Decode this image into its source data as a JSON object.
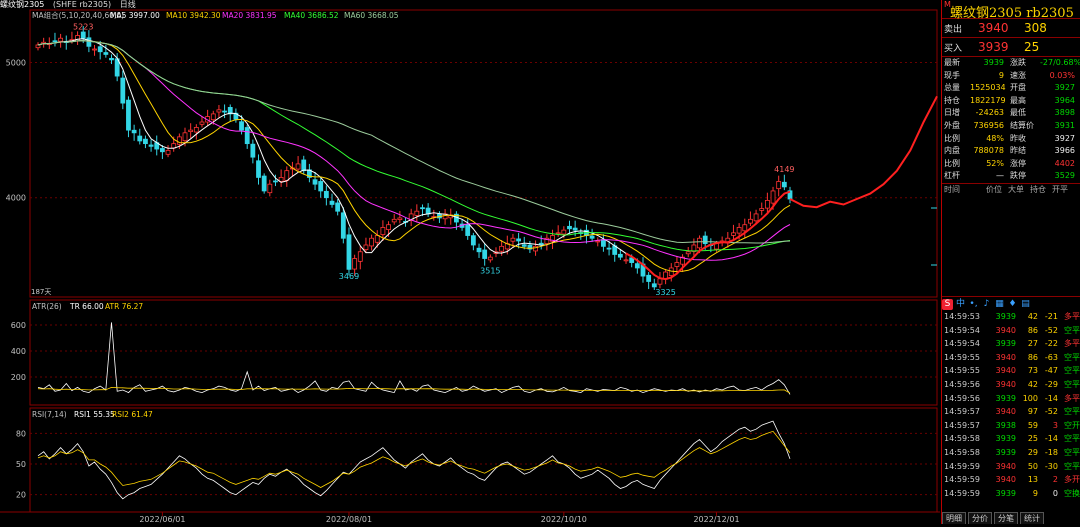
{
  "top_bar": {
    "symbol_label": "螺纹钢2305",
    "code_label": "(SHFE rb2305)",
    "period": "日线",
    "ma_header": "MA组合(5,10,20,40,60,0)",
    "ma5": "MA5 3997.00",
    "ma10": "MA10 3942.30",
    "ma20": "MA20 3831.95",
    "ma40": "MA40 3686.52",
    "ma60": "MA60 3668.05"
  },
  "colors": {
    "up": "#ff3333",
    "down": "#33d6e6",
    "ma5": "#ffffff",
    "ma10": "#ffd400",
    "ma20": "#ff33ff",
    "ma40": "#33ff33",
    "ma60": "#9ccc9c",
    "forecast": "#ff2020"
  },
  "chart_data": [
    {
      "type": "candlestick",
      "title": "螺纹钢2305 日线",
      "y_ticks": [
        "5000",
        "4000"
      ],
      "ylim": [
        3280,
        5300
      ],
      "x_ticks": [
        "2022/06/01",
        "2022/08/01",
        "2022/10/10",
        "2022/12/01"
      ],
      "annotations": {
        "high_1": "5223",
        "low_1": "3469",
        "low_2": "3515",
        "low_3": "3325",
        "high_2": "4149"
      },
      "counter_label": "187天",
      "close": [
        5130,
        5150,
        5140,
        5160,
        5180,
        5150,
        5170,
        5200,
        5180,
        5120,
        5100,
        5080,
        5060,
        5020,
        4900,
        4700,
        4500,
        4480,
        4420,
        4400,
        4380,
        4360,
        4340,
        4350,
        4400,
        4450,
        4480,
        4500,
        4520,
        4560,
        4600,
        4620,
        4650,
        4640,
        4620,
        4580,
        4500,
        4400,
        4300,
        4150,
        4050,
        4100,
        4120,
        4150,
        4200,
        4220,
        4250,
        4200,
        4150,
        4100,
        4050,
        4000,
        3950,
        3900,
        3700,
        3470,
        3550,
        3600,
        3650,
        3700,
        3720,
        3780,
        3800,
        3840,
        3850,
        3820,
        3880,
        3900,
        3920,
        3880,
        3860,
        3850,
        3880,
        3870,
        3820,
        3780,
        3720,
        3650,
        3600,
        3550,
        3560,
        3600,
        3640,
        3660,
        3700,
        3680,
        3640,
        3620,
        3640,
        3660,
        3700,
        3720,
        3740,
        3760,
        3770,
        3760,
        3740,
        3720,
        3700,
        3680,
        3640,
        3620,
        3580,
        3560,
        3540,
        3520,
        3480,
        3420,
        3380,
        3340,
        3400,
        3450,
        3480,
        3520,
        3560,
        3600,
        3650,
        3700,
        3660,
        3650,
        3660,
        3680,
        3700,
        3740,
        3780,
        3800,
        3840,
        3880,
        3920,
        3980,
        4050,
        4120,
        4080,
        3990
      ],
      "ma5": [],
      "forecast": [
        3990,
        3940,
        3930,
        3970,
        3950,
        3990,
        4030,
        4100,
        4200,
        4350,
        4560,
        4750
      ]
    },
    {
      "type": "line",
      "title": "ATR(26)",
      "legend": [
        "TR 66.00",
        "ATR 76.27"
      ],
      "y_ticks": [
        "600",
        "400",
        "200"
      ],
      "ylim": [
        0,
        700
      ],
      "series": [
        {
          "name": "TR 66.00",
          "values": [
            120,
            110,
            140,
            90,
            100,
            150,
            95,
            120,
            90,
            80,
            110,
            130,
            100,
            620,
            90,
            100,
            80,
            120,
            140,
            90,
            100,
            110,
            130,
            95,
            85,
            100,
            120,
            110,
            90,
            80,
            100,
            110,
            130,
            120,
            100,
            90,
            110,
            240,
            100,
            130,
            95,
            110,
            120,
            90,
            100,
            110,
            80,
            100,
            130,
            170,
            100,
            90,
            120,
            110,
            160,
            170,
            110,
            100,
            90,
            160,
            120,
            100,
            90,
            80,
            170,
            100,
            110,
            90,
            130,
            140,
            100,
            90,
            80,
            100,
            120,
            90,
            100,
            130,
            110,
            90,
            100,
            110,
            80,
            100,
            120,
            130,
            90,
            80,
            100,
            110,
            90,
            85,
            100,
            120,
            95,
            90,
            80,
            110,
            100,
            90,
            105,
            100,
            95,
            120,
            110,
            90,
            100,
            80,
            95,
            110,
            100,
            90,
            100,
            95,
            110,
            90,
            100,
            85,
            100,
            90,
            110,
            100,
            120,
            130,
            100,
            95,
            110,
            120,
            100,
            130,
            150,
            180,
            140,
            66
          ]
        },
        {
          "name": "ATR 76.27",
          "values": [
            110,
            108,
            110,
            106,
            104,
            106,
            104,
            104,
            103,
            101,
            101,
            102,
            102,
            120,
            118,
            117,
            114,
            114,
            115,
            113,
            112,
            112,
            113,
            111,
            108,
            108,
            109,
            109,
            107,
            105,
            105,
            105,
            106,
            107,
            106,
            104,
            104,
            109,
            109,
            110,
            109,
            109,
            109,
            108,
            107,
            107,
            106,
            106,
            107,
            109,
            108,
            107,
            107,
            107,
            109,
            112,
            111,
            111,
            109,
            111,
            111,
            110,
            109,
            107,
            110,
            109,
            109,
            109,
            109,
            110,
            109,
            108,
            106,
            106,
            106,
            106,
            105,
            106,
            106,
            105,
            105,
            104,
            103,
            103,
            104,
            104,
            103,
            101,
            101,
            101,
            100,
            99,
            99,
            99,
            99,
            98,
            97,
            97,
            97,
            96,
            96,
            96,
            96,
            97,
            97,
            96,
            96,
            95,
            95,
            95,
            95,
            95,
            95,
            95,
            95,
            94,
            94,
            94,
            94,
            94,
            94,
            94,
            95,
            96,
            96,
            96,
            96,
            96,
            96,
            97,
            98,
            100,
            101,
            76
          ]
        }
      ]
    },
    {
      "type": "line",
      "title": "RSI(7,14)",
      "legend": [
        "RSI1 55.35",
        "RSI2 61.47"
      ],
      "y_ticks": [
        "80",
        "50",
        "20"
      ],
      "ylim": [
        5,
        95
      ],
      "series": [
        {
          "name": "RSI1 55.35",
          "values": [
            58,
            62,
            55,
            60,
            66,
            60,
            64,
            70,
            62,
            48,
            52,
            45,
            40,
            32,
            22,
            16,
            20,
            22,
            26,
            28,
            30,
            35,
            40,
            46,
            52,
            58,
            55,
            50,
            46,
            40,
            36,
            34,
            30,
            26,
            22,
            20,
            24,
            28,
            32,
            30,
            36,
            40,
            38,
            42,
            45,
            40,
            36,
            30,
            26,
            22,
            19,
            24,
            30,
            36,
            42,
            40,
            46,
            52,
            55,
            58,
            62,
            66,
            60,
            54,
            50,
            46,
            52,
            56,
            60,
            54,
            50,
            48,
            52,
            56,
            50,
            46,
            42,
            40,
            36,
            34,
            40,
            46,
            50,
            52,
            48,
            44,
            40,
            42,
            46,
            50,
            54,
            58,
            52,
            50,
            46,
            40,
            36,
            38,
            40,
            44,
            40,
            36,
            30,
            26,
            28,
            32,
            34,
            30,
            28,
            26,
            34,
            40,
            46,
            52,
            58,
            64,
            70,
            74,
            68,
            62,
            66,
            72,
            76,
            80,
            84,
            86,
            82,
            84,
            88,
            90,
            92,
            80,
            70,
            55
          ]
        },
        {
          "name": "RSI2 61.47",
          "values": [
            56,
            58,
            56,
            58,
            62,
            60,
            61,
            64,
            61,
            54,
            54,
            50,
            47,
            42,
            35,
            29,
            30,
            31,
            33,
            34,
            35,
            38,
            41,
            45,
            49,
            53,
            52,
            50,
            48,
            45,
            42,
            41,
            38,
            35,
            32,
            30,
            32,
            34,
            36,
            35,
            38,
            41,
            40,
            42,
            44,
            42,
            40,
            36,
            33,
            30,
            27,
            30,
            33,
            37,
            41,
            40,
            43,
            47,
            49,
            51,
            54,
            57,
            55,
            52,
            50,
            48,
            51,
            53,
            55,
            52,
            50,
            49,
            51,
            53,
            50,
            48,
            46,
            45,
            43,
            41,
            44,
            47,
            49,
            50,
            48,
            46,
            44,
            45,
            47,
            49,
            51,
            54,
            51,
            50,
            48,
            45,
            43,
            44,
            45,
            47,
            45,
            43,
            40,
            37,
            38,
            40,
            41,
            39,
            38,
            37,
            41,
            44,
            48,
            51,
            55,
            59,
            63,
            66,
            63,
            60,
            62,
            65,
            68,
            71,
            74,
            76,
            74,
            75,
            78,
            80,
            82,
            75,
            68,
            61
          ]
        }
      ]
    }
  ],
  "indicator_labels": {
    "atr_title": "ATR(26)",
    "atr_tr": "TR 66.00",
    "atr_val": "ATR 76.27",
    "rsi_title": "RSI(7,14)",
    "rsi1": "RSI1 55.35",
    "rsi2": "RSI2 61.47"
  },
  "right_panel": {
    "title": "螺纹钢2305 rb2305",
    "flag": "M",
    "sell_label": "卖出",
    "sell_price": "3940",
    "sell_vol": "308",
    "buy_label": "买入",
    "buy_price": "3939",
    "buy_vol": "25",
    "quotes": [
      {
        "k1": "最新",
        "v1": "3939",
        "c1": "green",
        "k2": "涨跌",
        "v2": "-27/0.68%",
        "c2": "green"
      },
      {
        "k1": "现手",
        "v1": "9",
        "c1": "yellow",
        "k2": "速涨",
        "v2": "0.03%",
        "c2": "red"
      },
      {
        "k1": "总量",
        "v1": "1525034",
        "c1": "yellow",
        "k2": "开盘",
        "v2": "3927",
        "c2": "green"
      },
      {
        "k1": "持仓",
        "v1": "1822179",
        "c1": "yellow",
        "k2": "最高",
        "v2": "3964",
        "c2": "green"
      },
      {
        "k1": "日增",
        "v1": "-24263",
        "c1": "yellow",
        "k2": "最低",
        "v2": "3898",
        "c2": "green"
      },
      {
        "k1": "外盘",
        "v1": "736956",
        "c1": "yellow",
        "k2": "结算价",
        "v2": "3931",
        "c2": "green"
      },
      {
        "k1": "比例",
        "v1": "48%",
        "c1": "yellow",
        "k2": "昨收",
        "v2": "3927",
        "c2": "white"
      },
      {
        "k1": "内盘",
        "v1": "788078",
        "c1": "yellow",
        "k2": "昨结",
        "v2": "3966",
        "c2": "white"
      },
      {
        "k1": "比例",
        "v1": "52%",
        "c1": "yellow",
        "k2": "涨停",
        "v2": "4402",
        "c2": "red"
      },
      {
        "k1": "杠杆",
        "v1": "—",
        "c1": "white",
        "k2": "跌停",
        "v2": "3529",
        "c2": "green"
      }
    ],
    "tick_header": [
      "时间",
      "价位",
      "大单",
      "持仓",
      "开平"
    ],
    "ticks": [
      {
        "t": "14:59:53",
        "p": "3939",
        "v": "42",
        "o": "-21",
        "d": "多平"
      },
      {
        "t": "14:59:54",
        "p": "3940",
        "v": "86",
        "o": "-52",
        "d": "空平"
      },
      {
        "t": "14:59:54",
        "p": "3939",
        "v": "27",
        "o": "-22",
        "d": "多平"
      },
      {
        "t": "14:59:55",
        "p": "3940",
        "v": "86",
        "o": "-63",
        "d": "空平"
      },
      {
        "t": "14:59:55",
        "p": "3940",
        "v": "73",
        "o": "-47",
        "d": "空平"
      },
      {
        "t": "14:59:56",
        "p": "3940",
        "v": "42",
        "o": "-29",
        "d": "空平"
      },
      {
        "t": "14:59:56",
        "p": "3939",
        "v": "100",
        "o": "-14",
        "d": "多平"
      },
      {
        "t": "14:59:57",
        "p": "3940",
        "v": "97",
        "o": "-52",
        "d": "空平"
      },
      {
        "t": "14:59:57",
        "p": "3938",
        "v": "59",
        "o": "3",
        "d": "空开"
      },
      {
        "t": "14:59:58",
        "p": "3939",
        "v": "25",
        "o": "-14",
        "d": "空平"
      },
      {
        "t": "14:59:58",
        "p": "3939",
        "v": "29",
        "o": "-18",
        "d": "空平"
      },
      {
        "t": "14:59:59",
        "p": "3940",
        "v": "50",
        "o": "-30",
        "d": "空平"
      },
      {
        "t": "14:59:59",
        "p": "3940",
        "v": "13",
        "o": "2",
        "d": "多开"
      },
      {
        "t": "14:59:59",
        "p": "3939",
        "v": "9",
        "o": "0",
        "d": "空换"
      }
    ],
    "bottom_tabs": [
      "明细",
      "分价",
      "分笔",
      "统计"
    ]
  }
}
